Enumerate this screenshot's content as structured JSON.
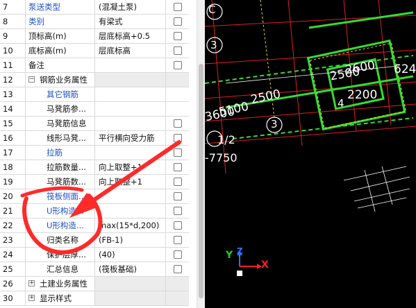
{
  "properties": {
    "rows": [
      {
        "num": "7",
        "name": "泵送类型",
        "value": "(混凝土泵)",
        "name_style": "blue",
        "checkbox": true,
        "value_bg": false
      },
      {
        "num": "8",
        "name": "类别",
        "value": "有梁式",
        "name_style": "blue",
        "checkbox": true,
        "value_bg": false
      },
      {
        "num": "9",
        "name": "顶标高(m)",
        "value": "层底标高+0.5",
        "name_style": "normal",
        "checkbox": true,
        "value_bg": false
      },
      {
        "num": "10",
        "name": "底标高(m)",
        "value": "层底标高",
        "name_style": "normal",
        "checkbox": true,
        "value_bg": false
      },
      {
        "num": "11",
        "name": "备注",
        "value": "",
        "name_style": "normal",
        "checkbox": true,
        "value_bg": false
      },
      {
        "num": "12",
        "name": "钢筋业务属性",
        "value": "",
        "name_style": "group",
        "checkbox": false,
        "value_bg": true,
        "expander": "−"
      },
      {
        "num": "13",
        "name": "其它钢筋",
        "value": "",
        "name_style": "blue-indent",
        "checkbox": false,
        "value_bg": false
      },
      {
        "num": "14",
        "name": "马凳筋参...",
        "value": "",
        "name_style": "indent",
        "checkbox": false,
        "value_bg": false
      },
      {
        "num": "15",
        "name": "马凳筋信息",
        "value": "",
        "name_style": "indent",
        "checkbox": true,
        "value_bg": false
      },
      {
        "num": "16",
        "name": "线形马凳...",
        "value": "平行横向受力筋",
        "name_style": "indent",
        "checkbox": true,
        "value_bg": false
      },
      {
        "num": "17",
        "name": "拉筋",
        "value": "",
        "name_style": "blue-indent",
        "checkbox": true,
        "value_bg": false
      },
      {
        "num": "18",
        "name": "拉筋数量...",
        "value": "向上取整+1",
        "name_style": "indent",
        "checkbox": true,
        "value_bg": false
      },
      {
        "num": "19",
        "name": "马凳筋数...",
        "value": "向上取整+1",
        "name_style": "indent",
        "checkbox": true,
        "value_bg": false
      },
      {
        "num": "20",
        "name": "筏板侧面...",
        "value": "",
        "name_style": "blue-indent",
        "checkbox": true,
        "value_bg": false
      },
      {
        "num": "21",
        "name": "U形构造...",
        "value": "",
        "name_style": "blue-indent",
        "checkbox": true,
        "value_bg": false
      },
      {
        "num": "22",
        "name": "U形构造...",
        "value": "max(15*d,200)",
        "name_style": "blue-indent",
        "checkbox": true,
        "value_bg": false
      },
      {
        "num": "23",
        "name": "归类名称",
        "value": "(FB-1)",
        "name_style": "indent",
        "checkbox": true,
        "value_bg": false
      },
      {
        "num": "24",
        "name": "保护层厚...",
        "value": "(40)",
        "name_style": "indent",
        "checkbox": true,
        "value_bg": false
      },
      {
        "num": "25",
        "name": "汇总信息",
        "value": "(筏板基础)",
        "name_style": "indent",
        "checkbox": true,
        "value_bg": false
      },
      {
        "num": "26",
        "name": "土建业务属性",
        "value": "",
        "name_style": "group",
        "checkbox": false,
        "value_bg": true,
        "expander": "+"
      },
      {
        "num": "30",
        "name": "显示样式",
        "value": "",
        "name_style": "group",
        "checkbox": false,
        "value_bg": true,
        "expander": "+"
      }
    ]
  },
  "cad": {
    "labels": [
      {
        "text": "C",
        "color": "#ffffff"
      },
      {
        "text": "3",
        "color": "#ffffff"
      },
      {
        "text": "2500",
        "color": "#ffffff"
      },
      {
        "text": "2600",
        "color": "#ffffff"
      },
      {
        "text": "4",
        "color": "#ffffff"
      },
      {
        "text": "2200",
        "color": "#ffffff"
      },
      {
        "text": "624",
        "color": "#ffffff"
      },
      {
        "text": "5100",
        "color": "#ffffff"
      },
      {
        "text": "2500",
        "color": "#ffffff"
      },
      {
        "text": "3600",
        "color": "#ffffff"
      },
      {
        "text": "3",
        "color": "#ffffff"
      },
      {
        "text": "1/2",
        "color": "#ffffff"
      },
      {
        "text": "-7750",
        "color": "#ffffff"
      }
    ],
    "axes": {
      "x_label": "X",
      "y_label": "Y",
      "z_label": "Z",
      "x_color": "#ff2020",
      "y_color": "#20d020",
      "z_color": "#3070ff"
    }
  },
  "annotation": {
    "color": "#ff2020"
  }
}
